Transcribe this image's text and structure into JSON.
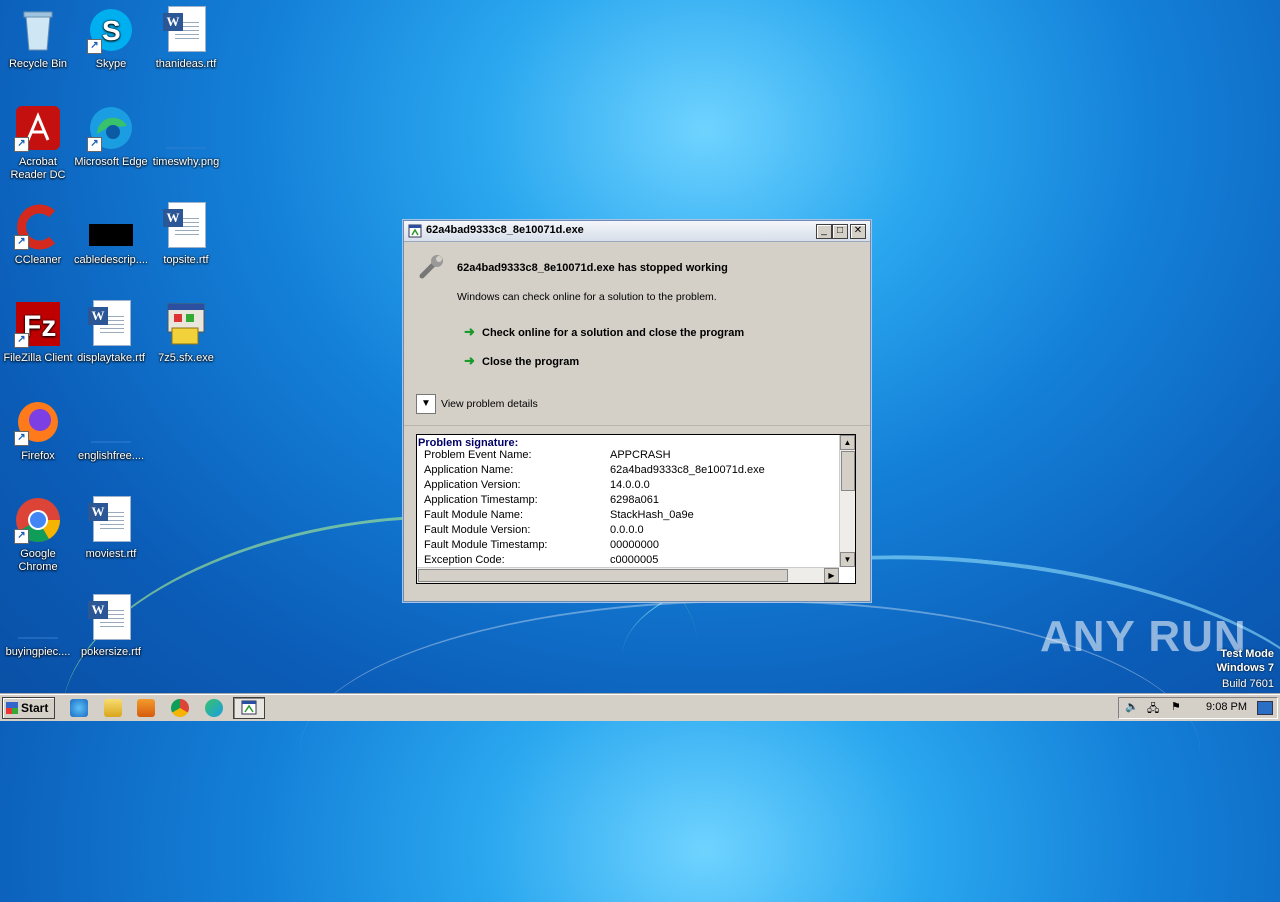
{
  "desktop": {
    "icons": [
      {
        "label": "Recycle Bin"
      },
      {
        "label": "Skype"
      },
      {
        "label": "thanideas.rtf"
      },
      {
        "label": "Acrobat Reader DC"
      },
      {
        "label": "Microsoft Edge"
      },
      {
        "label": "timeswhy.png"
      },
      {
        "label": "CCleaner"
      },
      {
        "label": "cabledescrip...."
      },
      {
        "label": "topsite.rtf"
      },
      {
        "label": "FileZilla Client"
      },
      {
        "label": "displaytake.rtf"
      },
      {
        "label": "7z5.sfx.exe"
      },
      {
        "label": "Firefox"
      },
      {
        "label": "englishfree...."
      },
      {
        "label": "Google Chrome"
      },
      {
        "label": "moviest.rtf"
      },
      {
        "label": "buyingpiec...."
      },
      {
        "label": "pokersize.rtf"
      }
    ]
  },
  "dialog": {
    "title": "62a4bad9333c8_8e10071d.exe",
    "headline": "62a4bad9333c8_8e10071d.exe has stopped working",
    "subtext": "Windows can check online for a solution to the problem.",
    "action_check": "Check online for a solution and close the program",
    "action_close": "Close the program",
    "details_toggle": "View problem details",
    "details": {
      "heading": "Problem signature:",
      "rows": [
        {
          "key": "Problem Event Name:",
          "value": "APPCRASH"
        },
        {
          "key": "Application Name:",
          "value": "62a4bad9333c8_8e10071d.exe"
        },
        {
          "key": "Application Version:",
          "value": "14.0.0.0"
        },
        {
          "key": "Application Timestamp:",
          "value": "6298a061"
        },
        {
          "key": "Fault Module Name:",
          "value": "StackHash_0a9e"
        },
        {
          "key": "Fault Module Version:",
          "value": "0.0.0.0"
        },
        {
          "key": "Fault Module Timestamp:",
          "value": "00000000"
        },
        {
          "key": "Exception Code:",
          "value": "c0000005"
        }
      ]
    }
  },
  "watermark": {
    "brand": "ANY RUN",
    "test_mode": "Test Mode",
    "os": "Windows 7",
    "build": "Build 7601"
  },
  "taskbar": {
    "start_label": "Start",
    "clock": "9:08 PM"
  }
}
